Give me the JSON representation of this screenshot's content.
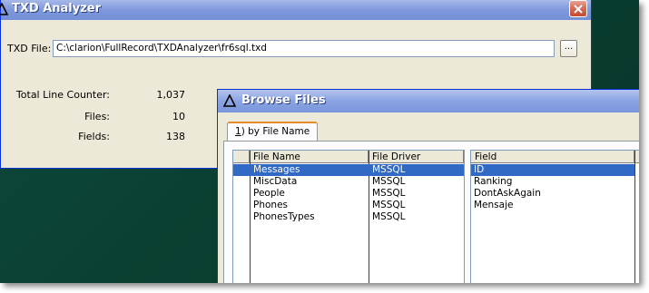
{
  "main_window": {
    "title": "TXD Analyzer",
    "txd_file_label": "TXD File:",
    "txd_file_value": "C:\\clarion\\FullRecord\\TXDAnalyzer\\fr6sql.txd",
    "browse_button_label": "...",
    "stats": [
      {
        "label": "Total Line Counter:",
        "value": "1,037"
      },
      {
        "label": "Files:",
        "value": "10"
      },
      {
        "label": "Fields:",
        "value": "138"
      }
    ]
  },
  "browse_window": {
    "title": "Browse Files",
    "tab_hotkey": "1",
    "tab_rest": ") by File Name",
    "files_columns": [
      "File Name",
      "File Driver"
    ],
    "files_rows": [
      {
        "name": "Messages",
        "driver": "MSSQL",
        "selected": true
      },
      {
        "name": "MiscData",
        "driver": "MSSQL",
        "selected": false
      },
      {
        "name": "People",
        "driver": "MSSQL",
        "selected": false
      },
      {
        "name": "Phones",
        "driver": "MSSQL",
        "selected": false
      },
      {
        "name": "PhonesTypes",
        "driver": "MSSQL",
        "selected": false
      }
    ],
    "fields_column": "Field",
    "fields_rows": [
      {
        "name": "ID",
        "selected": true
      },
      {
        "name": "Ranking",
        "selected": false
      },
      {
        "name": "DontAskAgain",
        "selected": false
      },
      {
        "name": "Mensaje",
        "selected": false
      }
    ]
  },
  "colors": {
    "titlebar": "#7e98dc",
    "selection": "#316ac5",
    "desktop": "#0a3f32",
    "tab_accent": "#e68b2c"
  },
  "icons": [
    "app-triangle-icon",
    "close-icon"
  ]
}
